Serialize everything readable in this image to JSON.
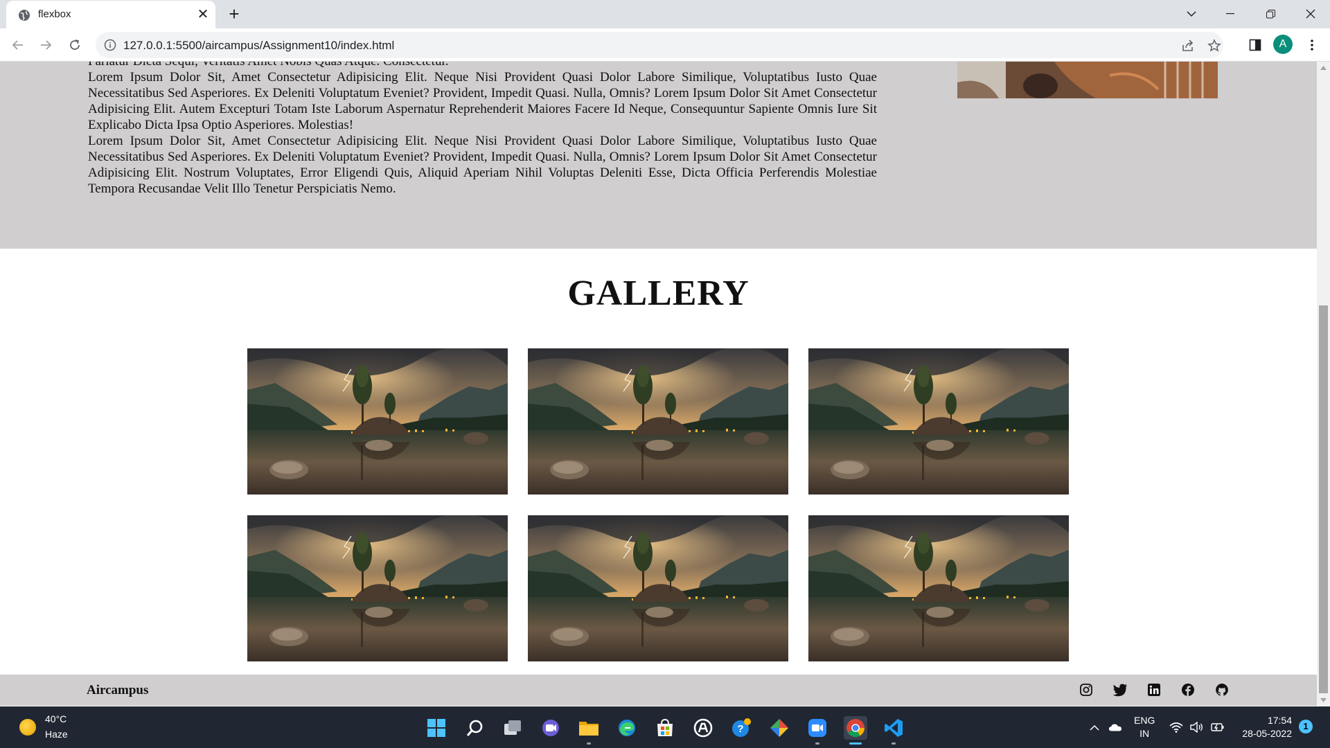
{
  "browser": {
    "tab_title": "flexbox",
    "url": "127.0.0.1:5500/aircampus/Assignment10/index.html",
    "profile_initial": "A"
  },
  "about": {
    "cut_line": "Pariatur Dicta Sequi, Veritatis Amet Nobis Quas Atque. Consectetur.",
    "paragraphs": [
      "Lorem ipsum dolor sit, amet consectetur adipisicing elit. Neque nisi provident quasi dolor labore similique, voluptatibus iusto quae necessitatibus sed asperiores. Ex deleniti voluptatum eveniet? Provident, impedit quasi. Nulla, omnis? Lorem ipsum dolor sit amet consectetur adipisicing elit. Autem excepturi totam iste laborum aspernatur reprehenderit maiores facere id neque, consequuntur sapiente omnis iure sit explicabo dicta ipsa optio asperiores. Molestias!",
      "Lorem ipsum dolor sit, amet consectetur adipisicing elit. Neque nisi provident quasi dolor labore similique, voluptatibus iusto quae necessitatibus sed asperiores. Ex deleniti voluptatum eveniet? Provident, impedit quasi. Nulla, omnis? Lorem ipsum dolor sit amet consectetur adipisicing elit. Nostrum voluptates, error eligendi quis, aliquid aperiam nihil voluptas deleniti esse, dicta officia perferendis molestiae tempora recusandae velit illo tenetur perspiciatis nemo."
    ]
  },
  "gallery": {
    "title": "GALLERY",
    "image_count": 6
  },
  "footer": {
    "brand": "Aircampus",
    "social_icons": [
      "instagram-icon",
      "twitter-icon",
      "linkedin-icon",
      "facebook-icon",
      "github-icon"
    ]
  },
  "taskbar": {
    "weather_temp": "40°C",
    "weather_condition": "Haze",
    "language_top": "ENG",
    "language_bottom": "IN",
    "time": "17:54",
    "date": "28-05-2022",
    "notification_count": "1"
  },
  "colors": {
    "section_bg": "#d0cecf",
    "chrome_tabbar": "#dee1e6",
    "taskbar_bg": "#202733",
    "accent": "#4cc2ff"
  }
}
